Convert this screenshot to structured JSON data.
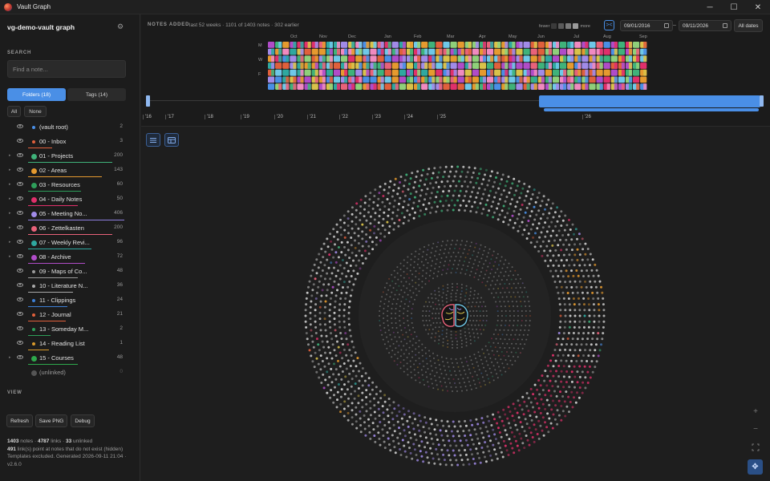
{
  "window": {
    "title": "Vault Graph",
    "minimize": "─",
    "maximize": "☐",
    "close": "✕"
  },
  "sidebar": {
    "vault_name": "vg-demo-vault graph",
    "settings_icon": "gear-icon",
    "search_label": "SEARCH",
    "search_placeholder": "Find a note...",
    "tabs": [
      {
        "label": "Folders (18)",
        "active": true
      },
      {
        "label": "Tags (14)",
        "active": false
      }
    ],
    "all_label": "All",
    "none_label": "None",
    "folders": [
      {
        "label": "(vault root)",
        "count": "2",
        "color": "#4a8fe6",
        "chevron": false,
        "underline": null
      },
      {
        "label": "00 - Inbox",
        "count": "3",
        "color": "#e0603c",
        "chevron": false,
        "underline": "#e0603c"
      },
      {
        "label": "01 - Projects",
        "count": "200",
        "color": "#3fb27a",
        "chevron": true,
        "underline": "#3fb27a"
      },
      {
        "label": "02 - Areas",
        "count": "143",
        "color": "#e59a2f",
        "chevron": true,
        "underline": "#e59a2f"
      },
      {
        "label": "03 - Resources",
        "count": "60",
        "color": "#2e9e5a",
        "chevron": true,
        "underline": "#2e9e5a"
      },
      {
        "label": "04 - Daily Notes",
        "count": "50",
        "color": "#e0306b",
        "chevron": true,
        "underline": "#e0306b"
      },
      {
        "label": "05 - Meeting No...",
        "count": "406",
        "color": "#a18be8",
        "chevron": true,
        "underline": "#8e7fe0"
      },
      {
        "label": "06 - Zettelkasten",
        "count": "200",
        "color": "#e8627a",
        "chevron": true,
        "underline": "#e8627a"
      },
      {
        "label": "07 - Weekly Revi...",
        "count": "96",
        "color": "#2fa8a0",
        "chevron": true,
        "underline": "#2fa8a0"
      },
      {
        "label": "08 - Archive",
        "count": "72",
        "color": "#b04cc8",
        "chevron": true,
        "underline": "#b04cc8"
      },
      {
        "label": "09 - Maps of Co...",
        "count": "48",
        "color": "#9a9a9a",
        "chevron": false,
        "underline": "#9a9a9a"
      },
      {
        "label": "10 - Literature N...",
        "count": "36",
        "color": "#a9a9a9",
        "chevron": false,
        "underline": "#a9a9a9"
      },
      {
        "label": "11 - Clippings",
        "count": "24",
        "color": "#3d7fd6",
        "chevron": false,
        "underline": "#3d7fd6"
      },
      {
        "label": "12 - Journal",
        "count": "21",
        "color": "#e0603c",
        "chevron": false,
        "underline": "#e0603c"
      },
      {
        "label": "13 - Someday M...",
        "count": "2",
        "color": "#2e9e5a",
        "chevron": false,
        "underline": "#2e9e5a"
      },
      {
        "label": "14 - Reading List",
        "count": "1",
        "color": "#d99a2b",
        "chevron": false,
        "underline": "#d99a2b"
      },
      {
        "label": "15 - Courses",
        "count": "48",
        "color": "#2ea84c",
        "chevron": true,
        "underline": "#2ea84c"
      },
      {
        "label": "(unlinked)",
        "count": "0",
        "color": "#555555",
        "chevron": false,
        "underline": null,
        "dim": true
      }
    ],
    "view_label": "VIEW",
    "refresh_label": "Refresh",
    "save_png_label": "Save PNG",
    "debug_label": "Debug",
    "stats": {
      "notes": "1403",
      "notes_label": " notes · ",
      "links": "4787",
      "links_label": " links · ",
      "unlinked": "33",
      "unlinked_label": " unlinked",
      "dangling": "491",
      "dangling_label": " link(s) point at notes that do not exist (hidden)",
      "footer": "Templates excluded. Generated 2026-09-11 21:04 · v2.6.0"
    }
  },
  "notes_added": {
    "title": "NOTES ADDED",
    "subtitle": "last 52 weeks · 1101 of 1403 notes · 302 earlier",
    "fewer_label": "fewer",
    "more_label": "more",
    "legend_colors": [
      "#3a3a3a",
      "#5a5a5a",
      "#7a7a7a",
      "#9a9a9a"
    ],
    "months": [
      "Oct",
      "Nov",
      "Dec",
      "Jan",
      "Feb",
      "Mar",
      "Apr",
      "May",
      "Jun",
      "Jul",
      "Aug",
      "Sep"
    ],
    "days": [
      "M",
      "W",
      "F"
    ],
    "date_from": "09/01/2016",
    "date_sep": "–",
    "date_to": "09/11/2026",
    "all_dates_label": "All dates",
    "years": [
      "'16",
      "'17",
      "'18",
      "'19",
      "'20",
      "'21",
      "'22",
      "'23",
      "'24",
      "'25",
      "'26"
    ],
    "palette": [
      "#3fb27a",
      "#e59a2f",
      "#e0306b",
      "#a18be8",
      "#e8627a",
      "#2fa8a0",
      "#b04cc8",
      "#4a8fe6",
      "#e0603c",
      "#d9c24a",
      "#8fd07a",
      "#f08ac0",
      "#6fc8e8"
    ]
  },
  "graph": {
    "center_icon": "brain-icon",
    "list_view_icon": "list-icon",
    "table_view_icon": "table-icon",
    "zoom_in": "+",
    "zoom_out": "−",
    "fit_icon": "fit-screen-icon",
    "pan_icon": "pan-move-icon",
    "pan_glyph": "✥"
  }
}
